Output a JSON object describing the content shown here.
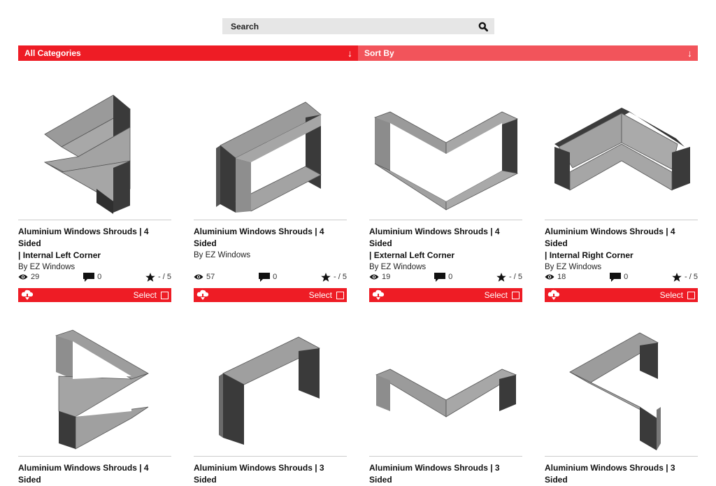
{
  "search": {
    "placeholder": "Search",
    "icon": "search-icon"
  },
  "filters": {
    "category_label": "All Categories",
    "sort_label": "Sort By",
    "arrow": "↓"
  },
  "colors": {
    "accent": "#ee1c25",
    "accent_light": "#f2545b",
    "search_bg": "#e6e6e6"
  },
  "rating_suffix": "- / 5",
  "select_label": "Select",
  "products": [
    {
      "title_line1": "Aluminium Windows Shrouds | 4 Sided",
      "title_line2": "| Internal Left Corner",
      "author": "By EZ Windows",
      "views": "29",
      "comments": "0",
      "rating": "- / 5"
    },
    {
      "title_line1": "Aluminium Windows Shrouds | 4 Sided",
      "title_line2": "",
      "author": "By EZ Windows",
      "views": "57",
      "comments": "0",
      "rating": "- / 5"
    },
    {
      "title_line1": "Aluminium Windows Shrouds | 4 Sided",
      "title_line2": "| External Left Corner",
      "author": "By EZ Windows",
      "views": "19",
      "comments": "0",
      "rating": "- / 5"
    },
    {
      "title_line1": "Aluminium Windows Shrouds | 4 Sided",
      "title_line2": "| Internal Right Corner",
      "author": "By EZ Windows",
      "views": "18",
      "comments": "0",
      "rating": "- / 5"
    },
    {
      "title_line1": "Aluminium Windows Shrouds | 4 Sided"
    },
    {
      "title_line1": "Aluminium Windows Shrouds | 3 Sided"
    },
    {
      "title_line1": "Aluminium Windows Shrouds | 3 Sided"
    },
    {
      "title_line1": "Aluminium Windows Shrouds | 3 Sided"
    }
  ]
}
